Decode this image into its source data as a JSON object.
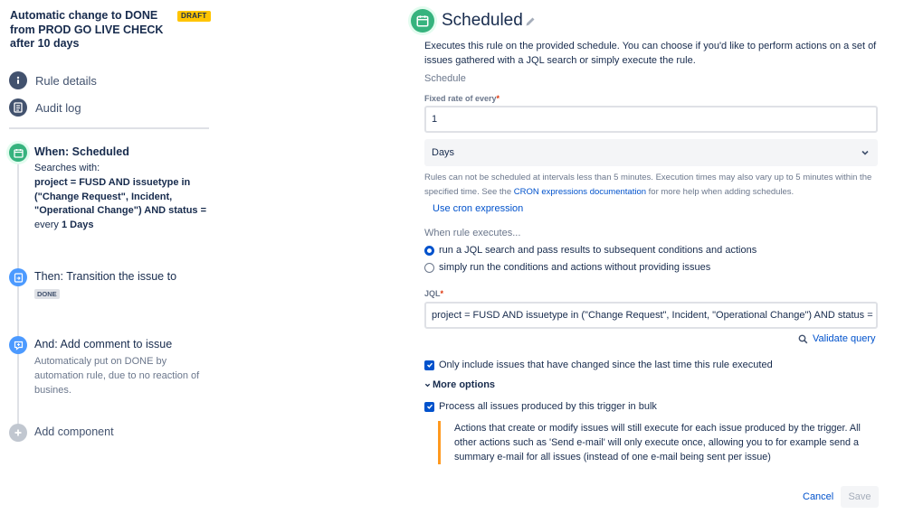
{
  "rule": {
    "title": "Automatic change to DONE from PROD GO LIVE CHECK after 10 days",
    "status_badge": "DRAFT"
  },
  "nav": {
    "details": "Rule details",
    "audit": "Audit log"
  },
  "steps": {
    "trigger": {
      "title": "When: Scheduled",
      "searches_label": "Searches with:",
      "jql": "project = FUSD AND issuetype in (\"Change Request\", Incident, \"Operational Change\") AND status =",
      "every_label": "every",
      "every_value": "1 Days"
    },
    "action": {
      "title": "Then: Transition the issue to",
      "lozenge": "DONE"
    },
    "comment": {
      "title": "And: Add comment to issue",
      "body": "Automaticaly put on DONE by automation rule, due to no reaction of busines."
    },
    "add": {
      "title": "Add component"
    }
  },
  "panel": {
    "title": "Scheduled",
    "description": "Executes this rule on the provided schedule. You can choose if you'd like to perform actions on a set of issues gathered with a JQL search or simply execute the rule.",
    "schedule_label": "Schedule",
    "fixed_rate_label": "Fixed rate of every",
    "required_mark": "*",
    "fixed_rate_value": "1",
    "unit_value": "Days",
    "hint_before": "Rules can not be scheduled at intervals less than 5 minutes. Execution times may also vary up to 5 minutes within the specified time. See the ",
    "hint_link": "CRON expressions documentation",
    "hint_after": " for more help when adding schedules.",
    "cron_link": "Use cron expression",
    "when_label": "When rule executes...",
    "radio_jql": "run a JQL search and pass results to subsequent conditions and actions",
    "radio_simple": "simply run the conditions and actions without providing issues",
    "jql_label": "JQL",
    "jql_value": "project = FUSD AND issuetype in (\"Change Request\", Incident, \"Operational Change\") AND status = \"Prod",
    "validate": "Validate query",
    "only_changed": "Only include issues that have changed since the last time this rule executed",
    "more_options": "More options",
    "bulk": "Process all issues produced by this trigger in bulk",
    "bulk_note": "Actions that create or modify issues will still execute for each issue produced by the trigger. All other actions such as 'Send e-mail' will only execute once, allowing you to for example send a summary e-mail for all issues (instead of one e-mail being sent per issue)",
    "cancel": "Cancel",
    "save": "Save"
  },
  "colors": {
    "trigger_green": "#36b37e",
    "action_blue": "#4c9aff",
    "link_blue": "#0052cc",
    "draft_yellow": "#ffc400",
    "note_orange": "#ff991f"
  }
}
